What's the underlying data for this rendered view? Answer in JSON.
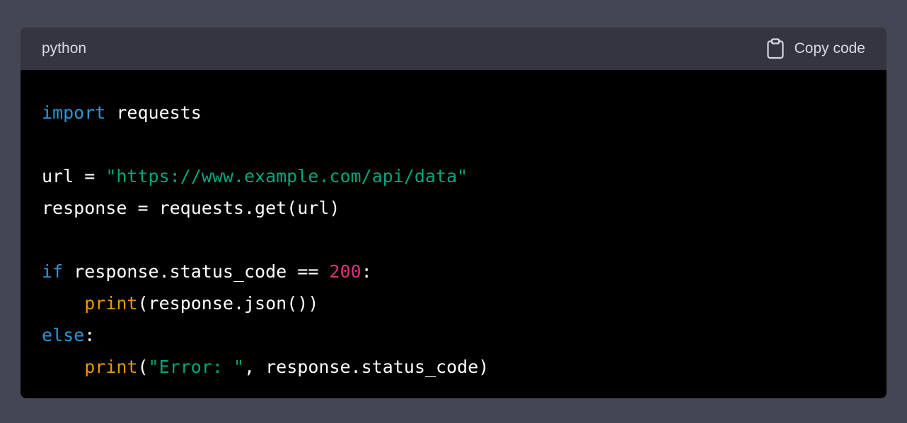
{
  "header": {
    "language": "python",
    "copy_label": "Copy code",
    "copy_icon": "clipboard-icon"
  },
  "colors": {
    "keyword": "#2e95d3",
    "string": "#00a67d",
    "number": "#df3079",
    "builtin": "#e9950c",
    "plain": "#ffffff",
    "header_bg": "#343541",
    "code_bg": "#000000",
    "page_bg": "#444654"
  },
  "code": {
    "lines": [
      [
        {
          "t": "import",
          "k": "keyword"
        },
        {
          "t": " requests",
          "k": "plain"
        }
      ],
      [],
      [
        {
          "t": "url = ",
          "k": "plain"
        },
        {
          "t": "\"https://www.example.com/api/data\"",
          "k": "string"
        }
      ],
      [
        {
          "t": "response = requests.get(url)",
          "k": "plain"
        }
      ],
      [],
      [
        {
          "t": "if",
          "k": "keyword"
        },
        {
          "t": " response.status_code == ",
          "k": "plain"
        },
        {
          "t": "200",
          "k": "number"
        },
        {
          "t": ":",
          "k": "plain"
        }
      ],
      [
        {
          "t": "    ",
          "k": "plain"
        },
        {
          "t": "print",
          "k": "builtin"
        },
        {
          "t": "(response.json())",
          "k": "plain"
        }
      ],
      [
        {
          "t": "else",
          "k": "keyword"
        },
        {
          "t": ":",
          "k": "plain"
        }
      ],
      [
        {
          "t": "    ",
          "k": "plain"
        },
        {
          "t": "print",
          "k": "builtin"
        },
        {
          "t": "(",
          "k": "plain"
        },
        {
          "t": "\"Error: \"",
          "k": "string"
        },
        {
          "t": ", response.status_code)",
          "k": "plain"
        }
      ]
    ]
  }
}
